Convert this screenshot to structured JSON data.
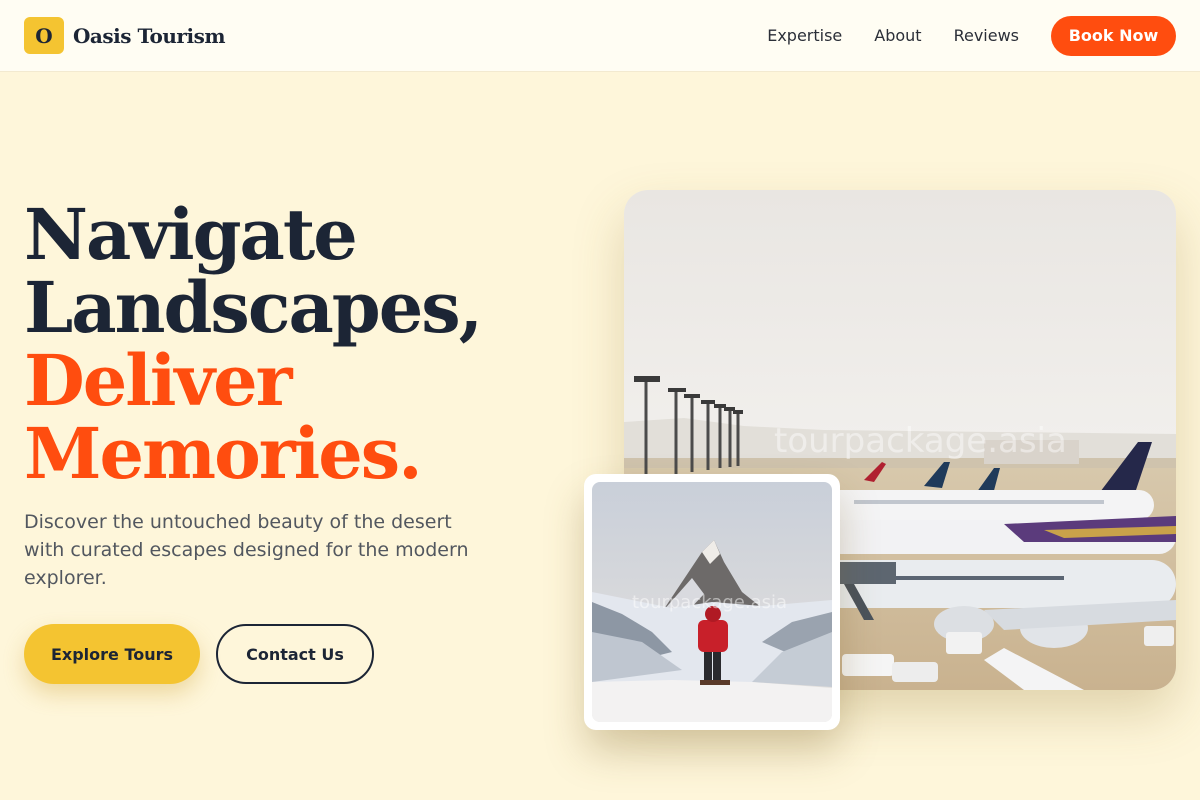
{
  "brand": {
    "logo_letter": "O",
    "name": "Oasis Tourism"
  },
  "nav": {
    "links": [
      "Expertise",
      "About",
      "Reviews"
    ],
    "cta": "Book Now"
  },
  "hero": {
    "title_line1": "Navigate",
    "title_line2": "Landscapes,",
    "title_line3": "Deliver",
    "title_line4": "Memories.",
    "description": "Discover the untouched beauty of the desert with curated escapes designed for the modern explorer.",
    "primary_button": "Explore Tours",
    "secondary_button": "Contact Us"
  },
  "images": {
    "main_watermark": "tourpackage.asia",
    "inset_watermark": "tourpackage.asia"
  },
  "colors": {
    "background": "#fef6da",
    "accent_orange": "#ff4d0f",
    "accent_yellow": "#f4c431",
    "dark_navy": "#1c2535"
  }
}
